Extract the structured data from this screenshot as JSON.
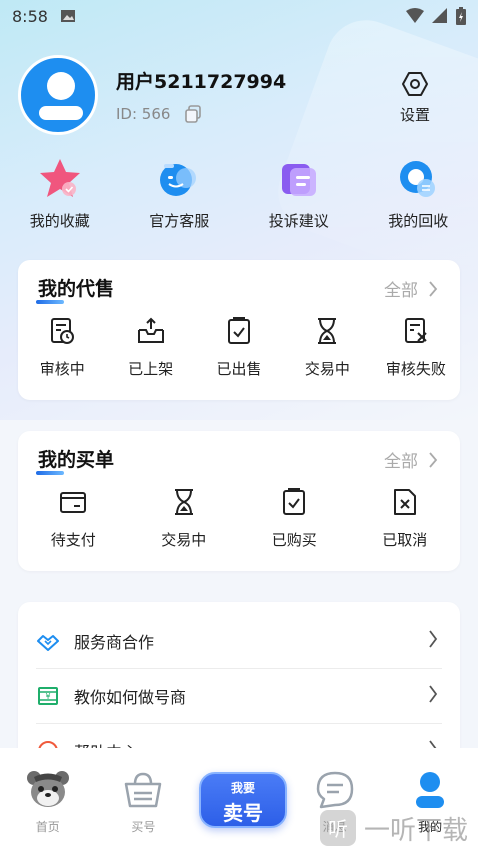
{
  "status_bar": {
    "time": "8:58"
  },
  "profile": {
    "username": "用户5211727994",
    "id_text": "ID: 566",
    "settings_label": "设置"
  },
  "quick_actions": [
    {
      "label": "我的收藏",
      "icon": "star-icon",
      "color": "#f0567e"
    },
    {
      "label": "官方客服",
      "icon": "customer-service-icon",
      "color": "#1e8ef0"
    },
    {
      "label": "投诉建议",
      "icon": "feedback-icon",
      "color": "#8a5cf0"
    },
    {
      "label": "我的回收",
      "icon": "recycle-icon",
      "color": "#1e8ef0"
    }
  ],
  "consignment": {
    "title": "我的代售",
    "more_label": "全部",
    "items": [
      {
        "label": "审核中",
        "icon": "review-pending-icon"
      },
      {
        "label": "已上架",
        "icon": "listed-icon"
      },
      {
        "label": "已出售",
        "icon": "sold-icon"
      },
      {
        "label": "交易中",
        "icon": "hourglass-icon"
      },
      {
        "label": "审核失败",
        "icon": "review-failed-icon"
      }
    ]
  },
  "purchases": {
    "title": "我的买单",
    "more_label": "全部",
    "items": [
      {
        "label": "待支付",
        "icon": "wallet-icon"
      },
      {
        "label": "交易中",
        "icon": "hourglass-icon"
      },
      {
        "label": "已购买",
        "icon": "purchased-icon"
      },
      {
        "label": "已取消",
        "icon": "cancelled-icon"
      }
    ]
  },
  "menu": [
    {
      "label": "服务商合作",
      "icon": "handshake-icon",
      "color": "#1e8ef0"
    },
    {
      "label": "教你如何做号商",
      "icon": "money-icon",
      "color": "#1fae6b"
    },
    {
      "label": "帮助中心",
      "icon": "help-icon",
      "color": "#f05a3c"
    }
  ],
  "bottom_nav": [
    {
      "label": "首页",
      "icon": "mascot-icon"
    },
    {
      "label": "买号",
      "icon": "shopping-basket-icon"
    },
    {
      "label_small": "我要",
      "label_big": "卖号",
      "icon": "sell-button"
    },
    {
      "label": "消息",
      "icon": "message-icon"
    },
    {
      "label": "我的",
      "icon": "user-icon",
      "active": true
    }
  ],
  "watermark": {
    "text": "一听下载"
  },
  "colors": {
    "accent": "#1e8ef0",
    "sell_button": "#2d5fe8"
  }
}
